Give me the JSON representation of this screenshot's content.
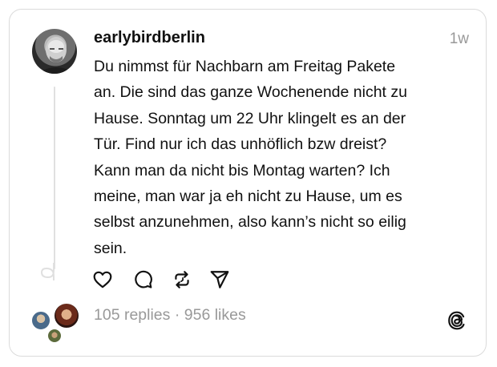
{
  "post": {
    "username": "earlybirdberlin",
    "timestamp": "1w",
    "text": "Du nimmst für Nachbarn am Freitag Pakete\nan. Die sind das ganze Wochenende nicht zu\nHause. Sonntag um 22 Uhr klingelt es an der\nTür. Find nur ich das unhöflich bzw dreist?\nKann man da nicht bis Montag warten? Ich\nmeine, man war ja eh nicht zu Hause, um es\nselbst anzunehmen, also kann’s nicht so eilig\nsein."
  },
  "actions": [
    {
      "icon": "heart-icon"
    },
    {
      "icon": "comment-icon"
    },
    {
      "icon": "repost-icon"
    },
    {
      "icon": "share-icon"
    }
  ],
  "stats": {
    "replies": "105 replies",
    "separator": " · ",
    "likes": "956 likes"
  },
  "colors": {
    "text": "#111111",
    "muted": "#999999",
    "border": "#dbdbdb",
    "thread_line": "#e0e0e0"
  }
}
